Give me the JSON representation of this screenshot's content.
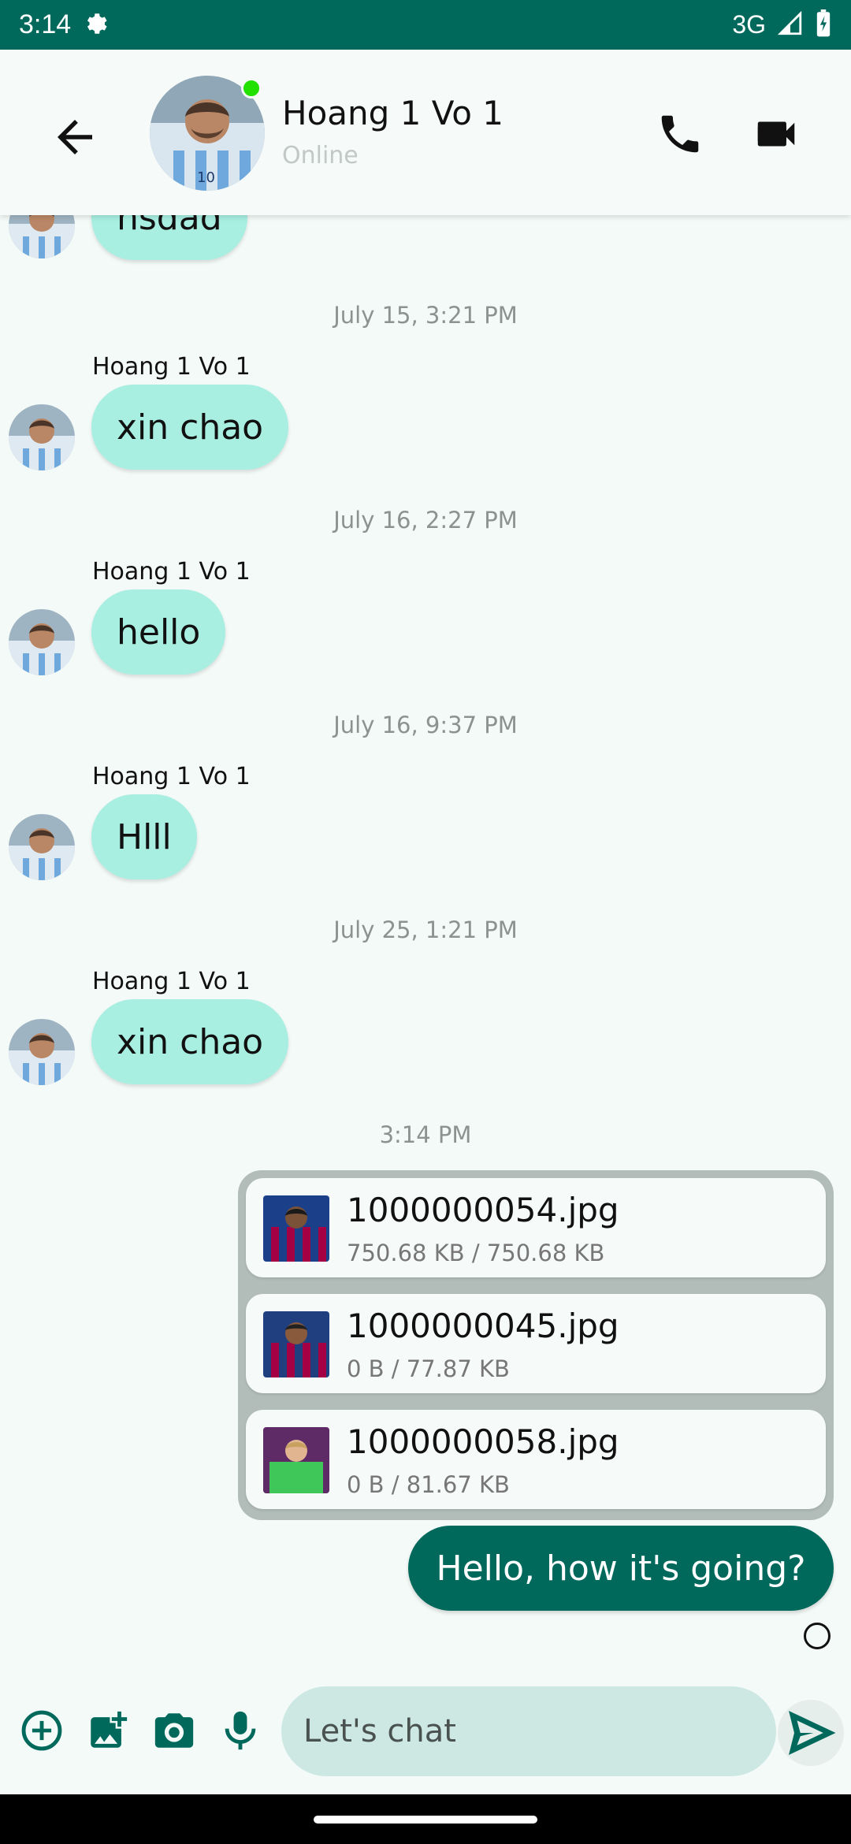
{
  "statusbar": {
    "time": "3:14",
    "network": "3G"
  },
  "header": {
    "contact_name": "Hoang 1 Vo 1",
    "contact_status": "Online"
  },
  "messages": [
    {
      "type": "incoming",
      "text": "hsdad"
    },
    {
      "timestamp": "July 15, 3:21 PM",
      "sender": "Hoang 1 Vo 1",
      "text": "xin chao"
    },
    {
      "timestamp": "July 16, 2:27 PM",
      "sender": "Hoang 1 Vo 1",
      "text": "hello"
    },
    {
      "timestamp": "July 16, 9:37 PM",
      "sender": "Hoang 1 Vo 1",
      "text": "Hlll"
    },
    {
      "timestamp": "July 25, 1:21 PM",
      "sender": "Hoang 1 Vo 1",
      "text": "xin chao"
    }
  ],
  "outgoing": {
    "timestamp": "3:14 PM",
    "files": [
      {
        "name": "1000000054.jpg",
        "size": "750.68 KB / 750.68 KB"
      },
      {
        "name": "1000000045.jpg",
        "size": "0 B / 77.87 KB"
      },
      {
        "name": "1000000058.jpg",
        "size": "0 B / 81.67 KB"
      }
    ],
    "text": "Hello, how it's going?"
  },
  "input": {
    "placeholder": "Let's chat"
  },
  "colors": {
    "primary": "#00695c",
    "incoming_bubble": "#a8efe2",
    "input_bg": "#cde8e3"
  }
}
